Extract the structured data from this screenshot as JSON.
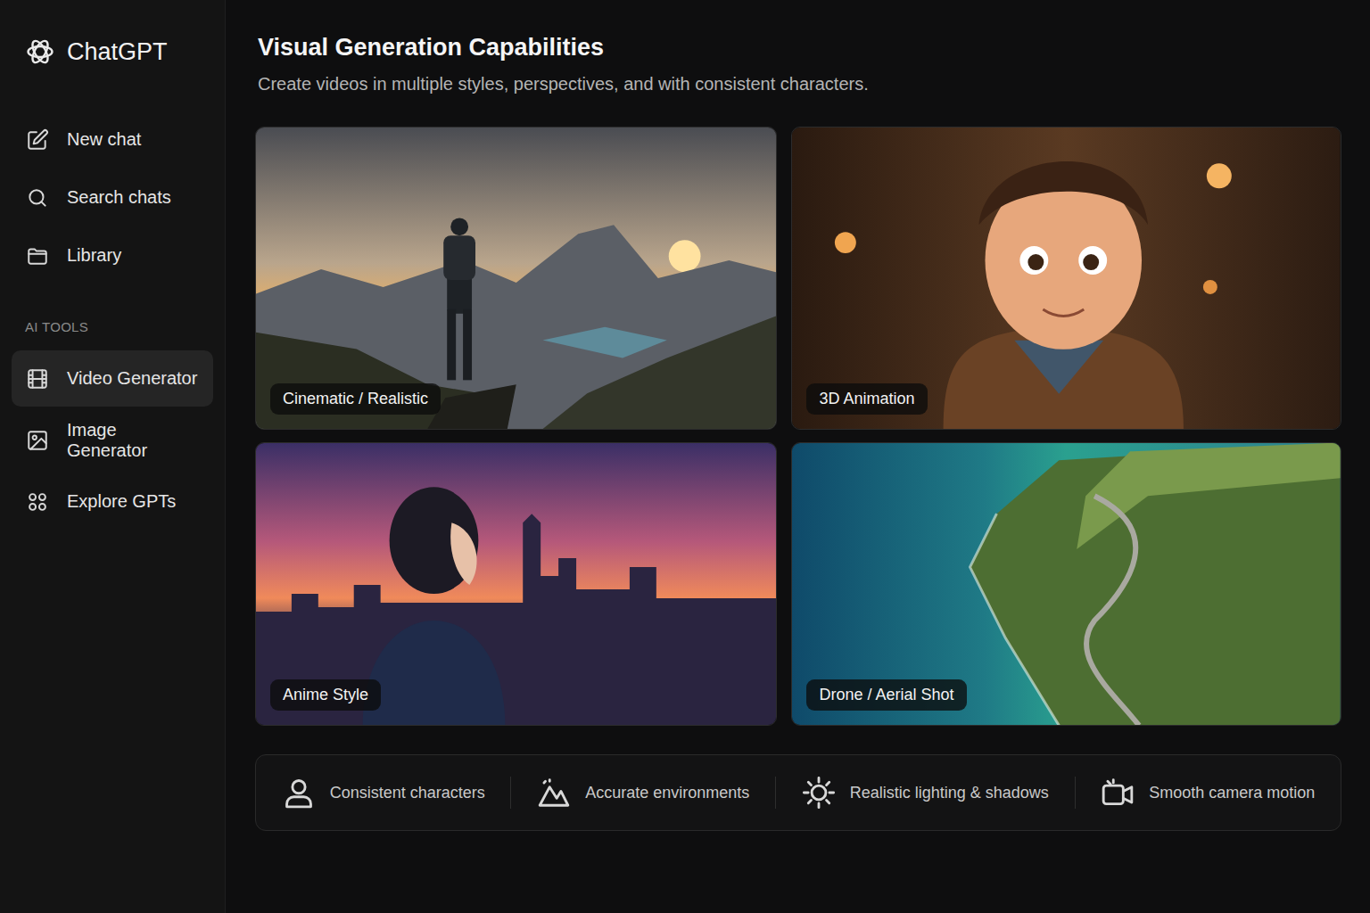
{
  "sidebar": {
    "logo": "ChatGPT",
    "items": [
      {
        "label": "New chat"
      },
      {
        "label": "Search chats"
      },
      {
        "label": "Library"
      }
    ],
    "section": "AI TOOLS",
    "tools": [
      {
        "label": "Video Generator",
        "selected": true
      },
      {
        "label": "Image Generator",
        "selected": false
      },
      {
        "label": "Explore GPTs",
        "selected": false
      }
    ]
  },
  "main": {
    "title": "Visual Generation Capabilities",
    "subtitle": "Create videos in multiple styles, perspectives, and with consistent characters.",
    "cards": [
      {
        "label": "Cinematic / Realistic"
      },
      {
        "label": "3D Animation"
      },
      {
        "label": "Anime Style"
      },
      {
        "label": "Drone / Aerial Shot"
      }
    ],
    "features": [
      {
        "label": "Consistent characters"
      },
      {
        "label": "Accurate environments"
      },
      {
        "label": "Realistic lighting & shadows"
      },
      {
        "label": "Smooth camera motion"
      }
    ]
  }
}
